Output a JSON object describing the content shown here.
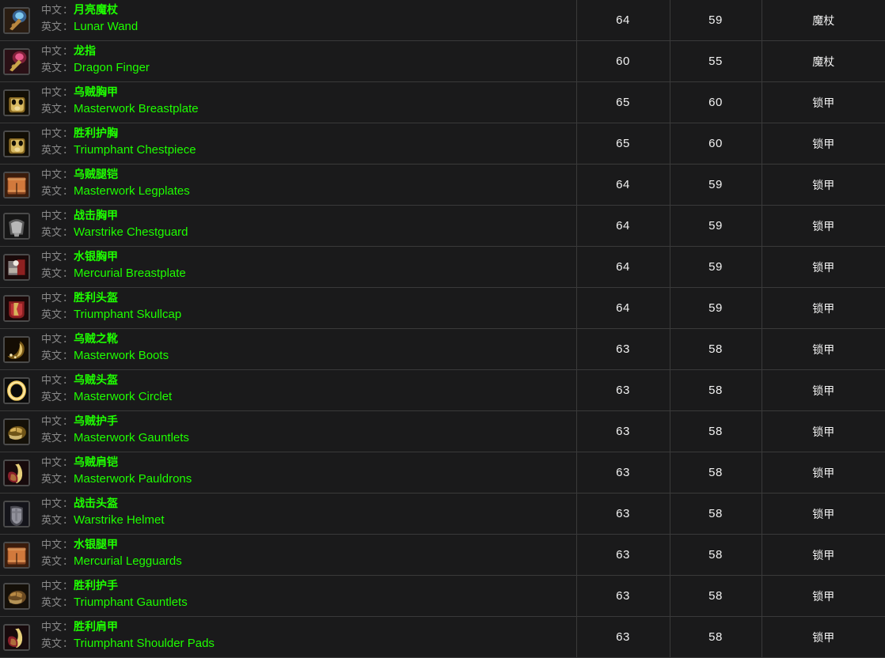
{
  "table": {
    "labels": {
      "cn": "中文",
      "en": "英文",
      "separator": "："
    },
    "rows": [
      {
        "cn": "月亮魔杖",
        "en": "Lunar Wand",
        "ilvl": "64",
        "req": "59",
        "type": "魔杖",
        "icon": "wand-blue",
        "colors": [
          "#3a6fa8",
          "#7fc8ef",
          "#2a1d12",
          "#b9873f"
        ]
      },
      {
        "cn": "龙指",
        "en": "Dragon Finger",
        "ilvl": "60",
        "req": "55",
        "type": "魔杖",
        "icon": "wand-pink",
        "colors": [
          "#8e2340",
          "#e85a8c",
          "#2a1016",
          "#c9a44a"
        ]
      },
      {
        "cn": "乌贼胸甲",
        "en": "Masterwork Breastplate",
        "ilvl": "65",
        "req": "60",
        "type": "锁甲",
        "icon": "chest-gold",
        "colors": [
          "#8a6a22",
          "#d9bb63",
          "#120e05",
          "#f2e2a8"
        ]
      },
      {
        "cn": "胜利护胸",
        "en": "Triumphant Chestpiece",
        "ilvl": "65",
        "req": "60",
        "type": "锁甲",
        "icon": "chest-gold",
        "colors": [
          "#8a6a22",
          "#d9bb63",
          "#120e05",
          "#f2e2a8"
        ]
      },
      {
        "cn": "乌贼腿铠",
        "en": "Masterwork Legplates",
        "ilvl": "64",
        "req": "59",
        "type": "锁甲",
        "icon": "legs-orange",
        "colors": [
          "#8d4a24",
          "#d2793c",
          "#3a1c0c",
          "#e8a668"
        ]
      },
      {
        "cn": "战击胸甲",
        "en": "Warstrike Chestguard",
        "ilvl": "64",
        "req": "59",
        "type": "锁甲",
        "icon": "chest-silver",
        "colors": [
          "#5c5c5c",
          "#cfcfcf",
          "#161616",
          "#9b9b9b"
        ]
      },
      {
        "cn": "水银胸甲",
        "en": "Mercurial Breastplate",
        "ilvl": "64",
        "req": "59",
        "type": "锁甲",
        "icon": "chest-red",
        "colors": [
          "#8e2020",
          "#cf4040",
          "#1a0a0a",
          "#d8d8d8"
        ]
      },
      {
        "cn": "胜利头盔",
        "en": "Triumphant Skullcap",
        "ilvl": "64",
        "req": "59",
        "type": "锁甲",
        "icon": "helm-red",
        "colors": [
          "#8c1f22",
          "#c83b3d",
          "#1a0808",
          "#d8b45a"
        ]
      },
      {
        "cn": "乌贼之靴",
        "en": "Masterwork Boots",
        "ilvl": "63",
        "req": "58",
        "type": "锁甲",
        "icon": "boots-gold",
        "colors": [
          "#7a5a18",
          "#e0c06a",
          "#140d04",
          "#f6e6b0"
        ]
      },
      {
        "cn": "乌贼头盔",
        "en": "Masterwork Circlet",
        "ilvl": "63",
        "req": "58",
        "type": "锁甲",
        "icon": "circlet-gold",
        "colors": [
          "#7a5a18",
          "#efc95f",
          "#0b0b0b",
          "#fff0b8"
        ]
      },
      {
        "cn": "乌贼护手",
        "en": "Masterwork Gauntlets",
        "ilvl": "63",
        "req": "58",
        "type": "锁甲",
        "icon": "gloves-gold",
        "colors": [
          "#6f5418",
          "#d8b258",
          "#141008",
          "#efd78f"
        ]
      },
      {
        "cn": "乌贼肩铠",
        "en": "Masterwork Pauldrons",
        "ilvl": "63",
        "req": "58",
        "type": "锁甲",
        "icon": "shoulder-red",
        "colors": [
          "#8a1f2a",
          "#c8a148",
          "#170a0c",
          "#e8cf7a"
        ]
      },
      {
        "cn": "战击头盔",
        "en": "Warstrike Helmet",
        "ilvl": "63",
        "req": "58",
        "type": "锁甲",
        "icon": "helm-steel",
        "colors": [
          "#4a4a52",
          "#a9a9b4",
          "#14141a",
          "#7a7a84"
        ]
      },
      {
        "cn": "水银腿甲",
        "en": "Mercurial Legguards",
        "ilvl": "63",
        "req": "58",
        "type": "锁甲",
        "icon": "legs-orange",
        "colors": [
          "#8d4a24",
          "#d2793c",
          "#3a1c0c",
          "#e8a668"
        ]
      },
      {
        "cn": "胜利护手",
        "en": "Triumphant Gauntlets",
        "ilvl": "63",
        "req": "58",
        "type": "锁甲",
        "icon": "gloves-brown",
        "colors": [
          "#6a4a22",
          "#b98a44",
          "#140f08",
          "#cfae6a"
        ]
      },
      {
        "cn": "胜利肩甲",
        "en": "Triumphant Shoulder Pads",
        "ilvl": "63",
        "req": "58",
        "type": "锁甲",
        "icon": "shoulder-red",
        "colors": [
          "#8a1f2a",
          "#c8a148",
          "#170a0c",
          "#e8cf7a"
        ]
      }
    ]
  }
}
